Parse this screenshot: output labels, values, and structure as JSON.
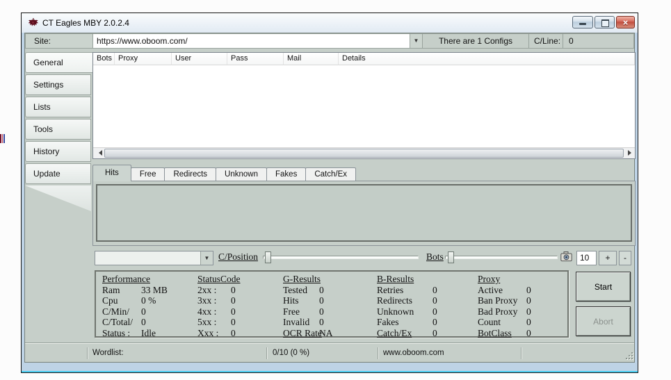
{
  "window": {
    "title": "CT Eagles MBY 2.0.2.4",
    "controls": {
      "minimize_icon": "minimize",
      "maximize_icon": "maximize",
      "close_icon": "close"
    }
  },
  "site_bar": {
    "label": "Site:",
    "url": "https://www.oboom.com/",
    "configs_text": "There are 1 Configs",
    "cline_label": "C/Line:",
    "cline_value": "0"
  },
  "sidebar": {
    "items": [
      {
        "label": "General",
        "active": true
      },
      {
        "label": "Settings",
        "active": false
      },
      {
        "label": "Lists",
        "active": false
      },
      {
        "label": "Tools",
        "active": false
      },
      {
        "label": "History",
        "active": false
      },
      {
        "label": "Update",
        "active": false
      }
    ]
  },
  "table": {
    "columns": [
      "Bots",
      "Proxy",
      "User",
      "Pass",
      "Mail",
      "Details"
    ],
    "rows": []
  },
  "result_tabs": [
    {
      "label": "Hits",
      "active": true
    },
    {
      "label": "Free",
      "active": false
    },
    {
      "label": "Redirects",
      "active": false
    },
    {
      "label": "Unknown",
      "active": false
    },
    {
      "label": "Fakes",
      "active": false
    },
    {
      "label": "Catch/Ex",
      "active": false
    }
  ],
  "controls_row": {
    "combo_value": "",
    "cposition_label": "C/Position",
    "bots_label": "Bots",
    "camera_icon": "camera",
    "count_value": "10",
    "plus_label": "+",
    "minus_label": "-"
  },
  "stats": {
    "performance": {
      "title": "Performance",
      "underline_last_label": false,
      "rows": [
        [
          "Ram",
          "33 MB"
        ],
        [
          "Cpu",
          "0 %"
        ],
        [
          "C/Min/",
          "0"
        ],
        [
          "C/Total/",
          "0"
        ],
        [
          "Status :",
          "Idle"
        ]
      ]
    },
    "statuscode": {
      "title": "StatusCode",
      "underline_last_label": false,
      "rows": [
        [
          "2xx :",
          "0"
        ],
        [
          "3xx :",
          "0"
        ],
        [
          "4xx :",
          "0"
        ],
        [
          "5xx :",
          "0"
        ],
        [
          "Xxx :",
          "0"
        ]
      ]
    },
    "g_results": {
      "title": "G-Results",
      "underline_last_label": true,
      "rows": [
        [
          "Tested",
          "0"
        ],
        [
          "Hits",
          "0"
        ],
        [
          "Free",
          "0"
        ],
        [
          "Invalid",
          "0"
        ],
        [
          "OCR Rate",
          "NA"
        ]
      ]
    },
    "b_results": {
      "title": "B-Results",
      "underline_last_label": true,
      "rows": [
        [
          "Retries",
          "0"
        ],
        [
          "Redirects",
          "0"
        ],
        [
          "Unknown",
          "0"
        ],
        [
          "Fakes",
          "0"
        ],
        [
          "Catch/Ex",
          "0"
        ]
      ]
    },
    "proxy": {
      "title": "Proxy",
      "underline_last_label": true,
      "rows": [
        [
          "Active",
          "0"
        ],
        [
          "Ban Proxy",
          "0"
        ],
        [
          "Bad Proxy",
          "0"
        ],
        [
          "Count",
          "0"
        ],
        [
          "BotClass",
          "0"
        ]
      ]
    }
  },
  "buttons": {
    "start": "Start",
    "abort": "Abort"
  },
  "statusbar": {
    "wordlist_label": "Wordlist:",
    "progress": "0/10 (0 %)",
    "site": "www.oboom.com"
  },
  "colors": {
    "window_bg": "#c6cfc9",
    "aero_border": "#bed3e6",
    "cyan_edge": "#49cdf1",
    "close_button": "#bf4a3c",
    "table_bg": "#ffffff"
  }
}
